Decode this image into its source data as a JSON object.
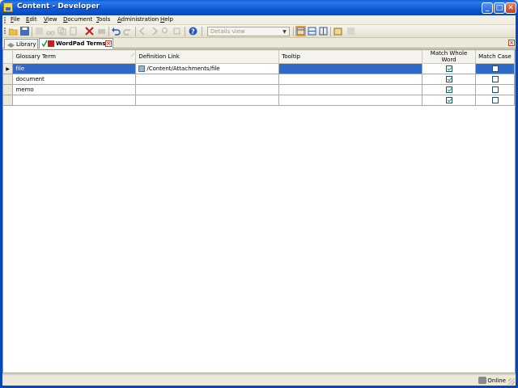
{
  "window": {
    "title": "Content - Developer",
    "minimize": "_",
    "maximize": "□",
    "close": "✕"
  },
  "menu": [
    "File",
    "Edit",
    "View",
    "Document",
    "Tools",
    "Administration",
    "Help"
  ],
  "toolbar": {
    "view_select": "Details view"
  },
  "tabs": [
    {
      "label": "Library",
      "icon": "library-icon",
      "active": false
    },
    {
      "label": "WordPad Terms",
      "icon": "terms-icon",
      "active": true
    }
  ],
  "grid": {
    "columns": [
      "Glossary Term",
      "Definition Link",
      "Tooltip",
      "Match Whole Word",
      "Match Case"
    ],
    "rows": [
      {
        "term": "file",
        "link": "/Content/Attachments/file",
        "tooltip": "",
        "whole": true,
        "case": false,
        "selected": true
      },
      {
        "term": "document",
        "link": "",
        "tooltip": "",
        "whole": true,
        "case": false,
        "selected": false
      },
      {
        "term": "memo",
        "link": "",
        "tooltip": "",
        "whole": true,
        "case": false,
        "selected": false
      },
      {
        "term": "",
        "link": "",
        "tooltip": "",
        "whole": true,
        "case": false,
        "selected": false
      }
    ]
  },
  "status": {
    "connection": "Online"
  },
  "colors": {
    "titlebar": "#0b58d6",
    "selection": "#316ac5",
    "check": "#21a121"
  }
}
